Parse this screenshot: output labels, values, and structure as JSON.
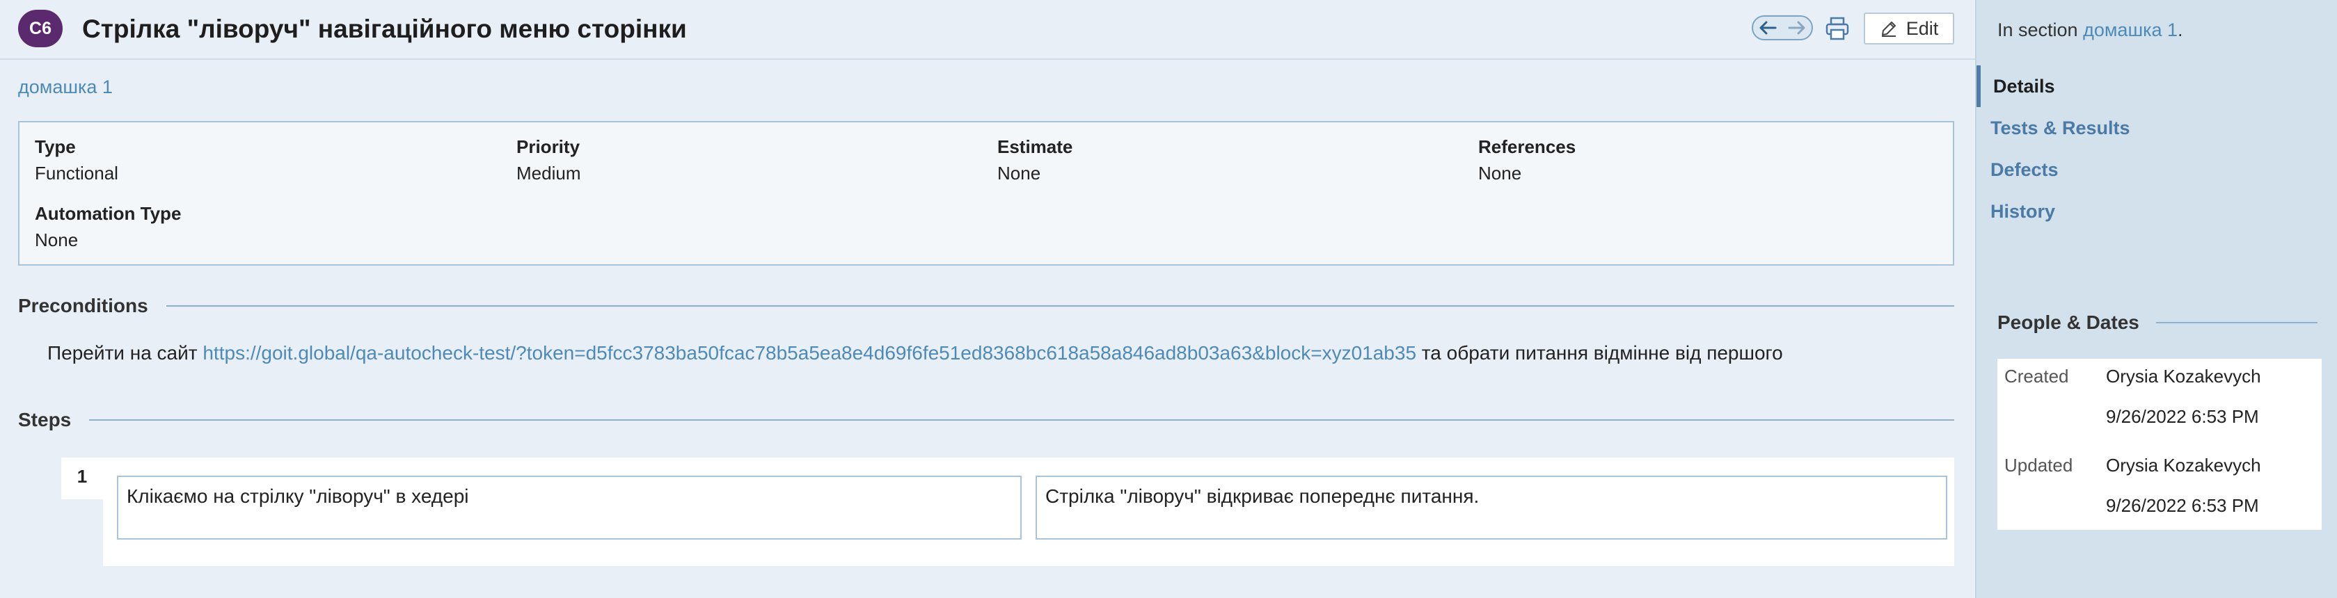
{
  "header": {
    "case_id": "C6",
    "title": "Стрілка \"ліворуч\" навігаційного меню сторінки",
    "edit_label": "Edit"
  },
  "breadcrumb": {
    "section_link": "домашка 1"
  },
  "info": {
    "type": {
      "label": "Type",
      "value": "Functional"
    },
    "priority": {
      "label": "Priority",
      "value": "Medium"
    },
    "estimate": {
      "label": "Estimate",
      "value": "None"
    },
    "references": {
      "label": "References",
      "value": "None"
    },
    "automation_type": {
      "label": "Automation Type",
      "value": "None"
    }
  },
  "preconditions": {
    "heading": "Preconditions",
    "prefix": "Перейти на сайт",
    "link": "https://goit.global/qa-autocheck-test/?token=d5fcc3783ba50fcac78b5a5ea8e4d69f6fe51ed8368bc618a58a846ad8b03a63&block=xyz01ab35",
    "suffix": "та обрати питання відмінне від першого"
  },
  "steps": {
    "heading": "Steps",
    "items": [
      {
        "number": "1",
        "action": "Клікаємо на стрілку \"ліворуч\" в хедері",
        "expected": "Стрілка \"ліворуч\" відкриває попереднє питання."
      }
    ]
  },
  "sidebar": {
    "section_prefix": "In section",
    "section_link": "домашка 1",
    "section_suffix": ".",
    "nav": [
      {
        "label": "Details",
        "active": true
      },
      {
        "label": "Tests & Results",
        "active": false
      },
      {
        "label": "Defects",
        "active": false
      },
      {
        "label": "History",
        "active": false
      }
    ],
    "people_dates": {
      "heading": "People & Dates",
      "created_label": "Created",
      "created_by": "Orysia Kozakevych",
      "created_at": "9/26/2022 6:53 PM",
      "updated_label": "Updated",
      "updated_by": "Orysia Kozakevych",
      "updated_at": "9/26/2022 6:53 PM"
    }
  },
  "icons": [
    "arrow-left-icon",
    "arrow-right-icon",
    "print-icon",
    "pencil-icon"
  ],
  "colors": {
    "badge": "#5b2a6e",
    "link": "#4e8ab8",
    "sidebar_bg": "#d3e1ec",
    "page_bg": "#e9eff6"
  }
}
